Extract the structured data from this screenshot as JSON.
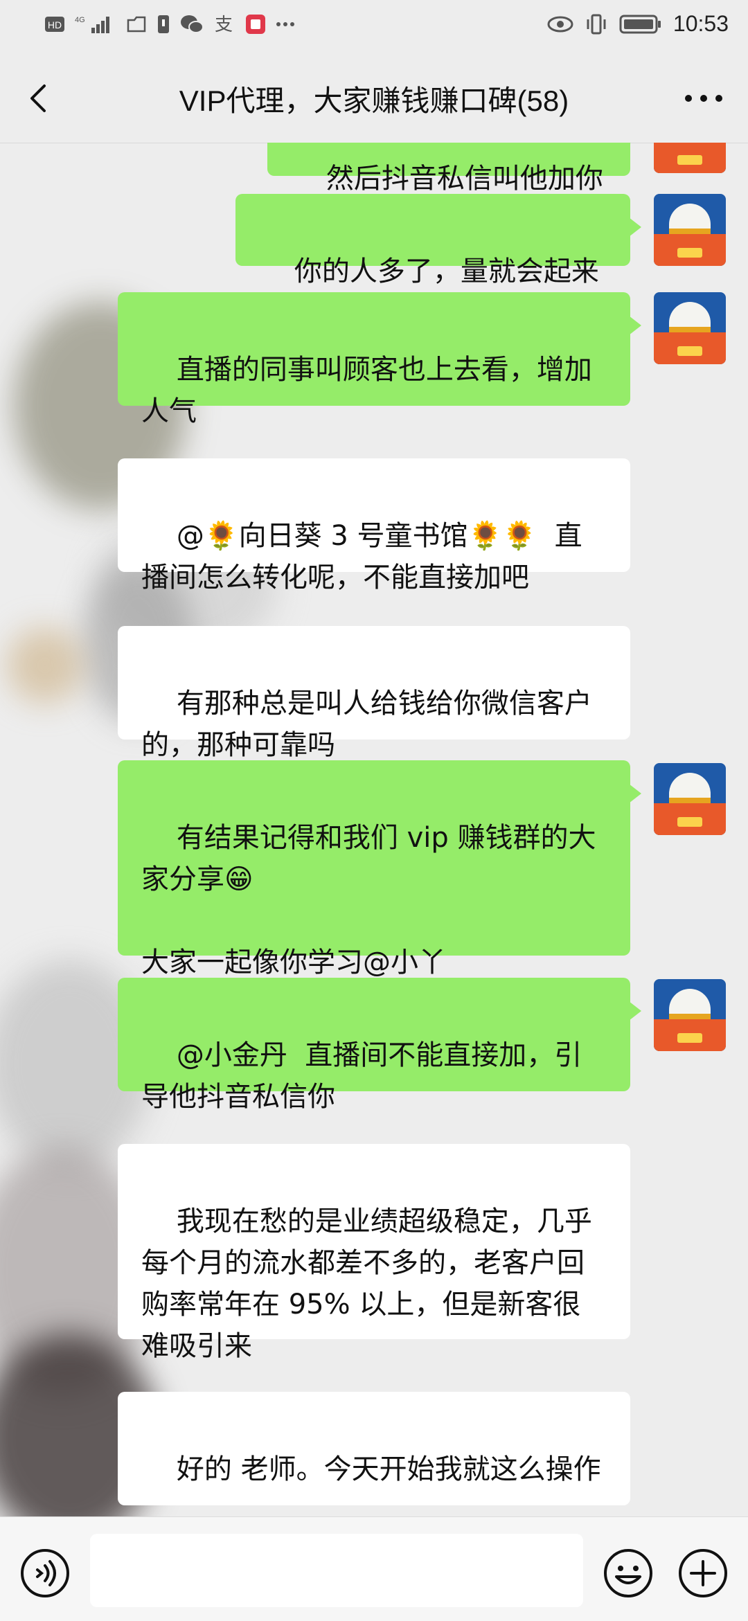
{
  "status_bar": {
    "time": "10:53",
    "network_label": "HD",
    "signal_label": "4G",
    "icons": [
      "hd-icon",
      "signal-icon",
      "folder-icon",
      "sim-icon",
      "wechat-icon",
      "alipay-icon",
      "app-red-icon",
      "more-dots-icon",
      "eye-icon",
      "vibrate-icon",
      "battery-icon"
    ]
  },
  "nav": {
    "title": "VIP代理，大家赚钱赚口碑(58)",
    "back_icon": "chevron-left-icon",
    "more_icon": "more-horizontal-icon"
  },
  "messages": [
    {
      "sender": "me",
      "text": "然后抖音私信叫他加你"
    },
    {
      "sender": "me",
      "text": "你的人多了，量就会起来"
    },
    {
      "sender": "me",
      "text": "直播的同事叫顾客也上去看，增加人气"
    },
    {
      "sender": "other",
      "text": "@🌻向日葵 3 号童书馆🌻🌻  直播间怎么转化呢，不能直接加吧"
    },
    {
      "sender": "other",
      "text": "有那种总是叫人给钱给你微信客户的，那种可靠吗"
    },
    {
      "sender": "me",
      "text": "有结果记得和我们 vip 赚钱群的大家分享😁\n\n大家一起像你学习@小丫"
    },
    {
      "sender": "me",
      "text": "@小金丹  直播间不能直接加，引导他抖音私信你"
    },
    {
      "sender": "other",
      "text": "我现在愁的是业绩超级稳定，几乎每个月的流水都差不多的，老客户回购率常年在 95% 以上，但是新客很难吸引来"
    },
    {
      "sender": "other",
      "text": "好的 老师。今天开始我就这么操作"
    }
  ],
  "input_bar": {
    "placeholder": "",
    "voice_icon": "voice-icon",
    "emoji_icon": "emoji-icon",
    "plus_icon": "plus-icon"
  },
  "colors": {
    "my_bubble": "#95ec69",
    "other_bubble": "#ffffff",
    "background": "#ededed"
  }
}
